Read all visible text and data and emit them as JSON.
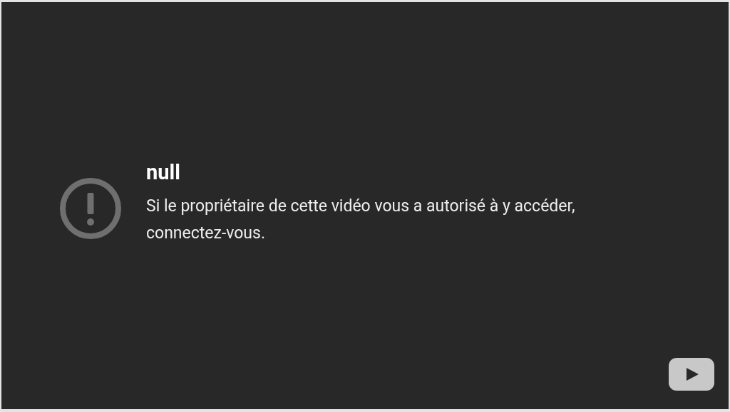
{
  "error": {
    "title": "null",
    "message": "Si le propriétaire de cette vidéo vous a autorisé à y accéder, connectez-vous."
  }
}
